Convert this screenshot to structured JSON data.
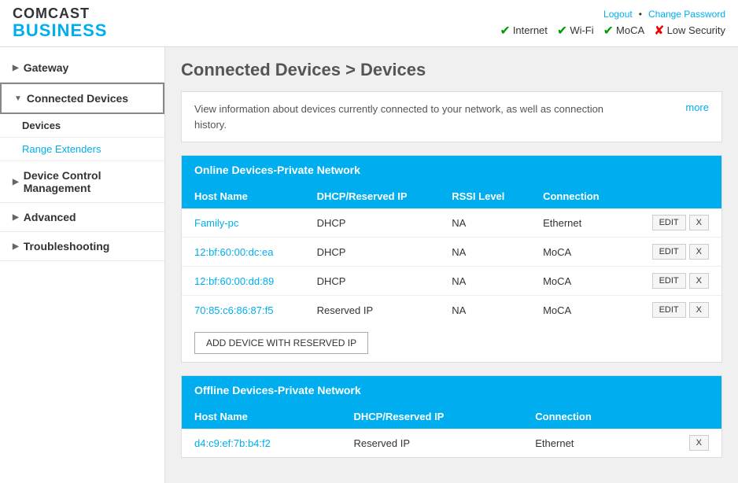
{
  "header": {
    "logo_comcast": "COMCAST",
    "logo_business": "BUSINESS",
    "links": {
      "logout": "Logout",
      "separator": "•",
      "change_password": "Change Password"
    },
    "status_items": [
      {
        "label": "Internet",
        "type": "ok"
      },
      {
        "label": "Wi-Fi",
        "type": "ok"
      },
      {
        "label": "MoCA",
        "type": "ok"
      },
      {
        "label": "Low Security",
        "type": "warn"
      }
    ]
  },
  "sidebar": {
    "items": [
      {
        "id": "gateway",
        "label": "Gateway",
        "arrow": "▶",
        "active": false
      },
      {
        "id": "connected-devices",
        "label": "Connected Devices",
        "arrow": "▼",
        "active": true,
        "children": [
          {
            "id": "devices",
            "label": "Devices",
            "active": true
          },
          {
            "id": "range-extenders",
            "label": "Range Extenders",
            "active": false
          }
        ]
      },
      {
        "id": "device-control",
        "label": "Device Control Management",
        "arrow": "▶",
        "active": false
      },
      {
        "id": "advanced",
        "label": "Advanced",
        "arrow": "▶",
        "active": false
      },
      {
        "id": "troubleshooting",
        "label": "Troubleshooting",
        "arrow": "▶",
        "active": false
      }
    ]
  },
  "page": {
    "title": "Connected Devices > Devices",
    "info_text": "View information about devices currently connected to your network, as well as connection history.",
    "more_link": "more"
  },
  "online_table": {
    "section_title": "Online Devices-Private Network",
    "columns": [
      "Host Name",
      "DHCP/Reserved IP",
      "RSSI Level",
      "Connection"
    ],
    "rows": [
      {
        "host": "Family-pc",
        "ip": "DHCP",
        "rssi": "NA",
        "connection": "Ethernet"
      },
      {
        "host": "12:bf:60:00:dc:ea",
        "ip": "DHCP",
        "rssi": "NA",
        "connection": "MoCA"
      },
      {
        "host": "12:bf:60:00:dd:89",
        "ip": "DHCP",
        "rssi": "NA",
        "connection": "MoCA"
      },
      {
        "host": "70:85:c6:86:87:f5",
        "ip": "Reserved IP",
        "rssi": "NA",
        "connection": "MoCA"
      }
    ],
    "add_button": "ADD DEVICE WITH RESERVED IP"
  },
  "offline_table": {
    "section_title": "Offline Devices-Private Network",
    "columns": [
      "Host Name",
      "DHCP/Reserved IP",
      "Connection"
    ],
    "rows": [
      {
        "host": "d4:c9:ef:7b:b4:f2",
        "ip": "Reserved IP",
        "connection": "Ethernet"
      }
    ]
  }
}
